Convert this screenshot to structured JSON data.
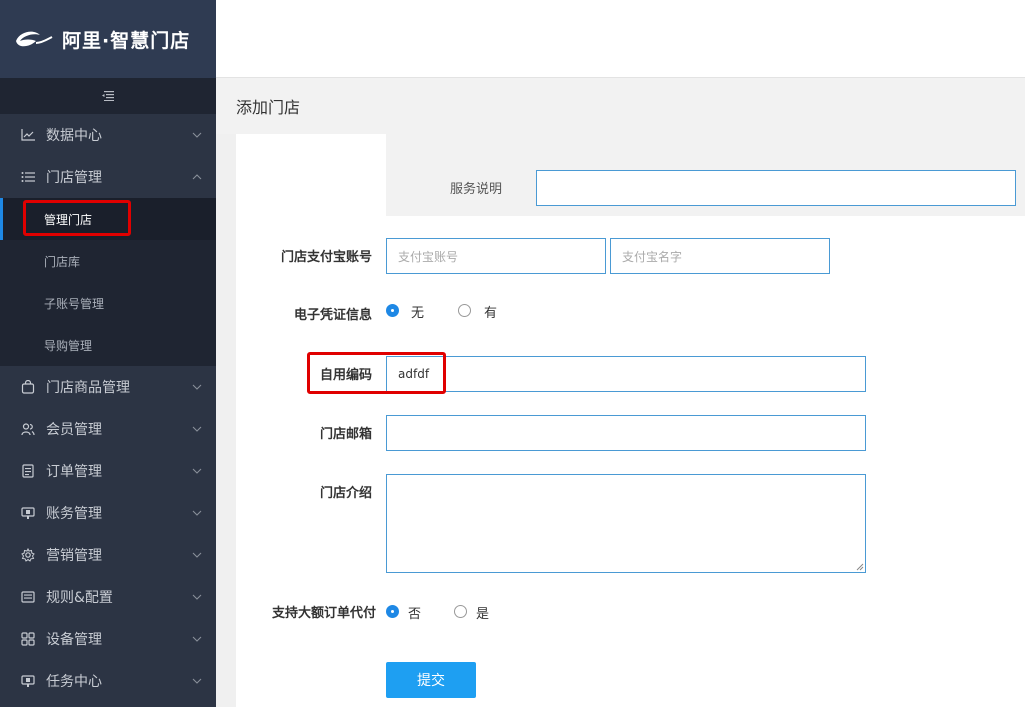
{
  "app": {
    "brand": "阿里·智慧门店",
    "collapse_icon": "menu-collapse-icon"
  },
  "sidebar": {
    "items": [
      {
        "label": "数据中心",
        "icon": "chart-line-icon",
        "expanded": false
      },
      {
        "label": "门店管理",
        "icon": "list-icon",
        "expanded": true,
        "children": [
          {
            "label": "管理门店",
            "active": true
          },
          {
            "label": "门店库",
            "active": false
          },
          {
            "label": "子账号管理",
            "active": false
          },
          {
            "label": "导购管理",
            "active": false
          }
        ]
      },
      {
        "label": "门店商品管理",
        "icon": "bag-icon",
        "expanded": false
      },
      {
        "label": "会员管理",
        "icon": "users-icon",
        "expanded": false
      },
      {
        "label": "订单管理",
        "icon": "order-icon",
        "expanded": false
      },
      {
        "label": "账务管理",
        "icon": "finance-icon",
        "expanded": false
      },
      {
        "label": "营销管理",
        "icon": "gear-icon",
        "expanded": false
      },
      {
        "label": "规则&配置",
        "icon": "rules-icon",
        "expanded": false
      },
      {
        "label": "设备管理",
        "icon": "grid-icon",
        "expanded": false
      },
      {
        "label": "任务中心",
        "icon": "task-icon",
        "expanded": false
      }
    ]
  },
  "page": {
    "title": "添加门店"
  },
  "form": {
    "service_desc_label": "服务说明",
    "service_desc_value": "",
    "alipay_label": "门店支付宝账号",
    "alipay_account_placeholder": "支付宝账号",
    "alipay_name_placeholder": "支付宝名字",
    "voucher_label": "电子凭证信息",
    "voucher_options": [
      "无",
      "有"
    ],
    "voucher_selected": "无",
    "custom_code_label": "自用编码",
    "custom_code_value": "adfdf",
    "email_label": "门店邮箱",
    "email_value": "",
    "intro_label": "门店介绍",
    "intro_value": "",
    "large_order_label": "支持大额订单代付",
    "large_order_options": [
      "否",
      "是"
    ],
    "large_order_selected": "否",
    "submit_label": "提交"
  },
  "colors": {
    "sidebar_bg": "#2c3444",
    "accent": "#1e88e5",
    "submit_bg": "#1e9ff2",
    "highlight": "#e00000"
  }
}
